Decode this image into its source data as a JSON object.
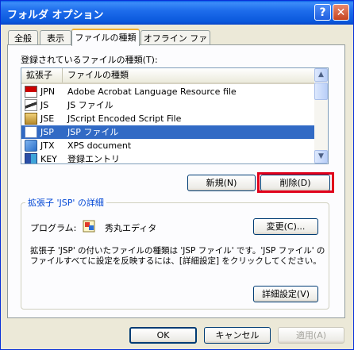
{
  "window": {
    "title": "フォルダ オプション",
    "help": "?",
    "close": "✕"
  },
  "tabs": [
    "全般",
    "表示",
    "ファイルの種類",
    "オフライン ファイル"
  ],
  "list_label": "登録されているファイルの種類(T):",
  "columns": {
    "ext": "拡張子",
    "type": "ファイルの種類"
  },
  "rows": [
    {
      "ext": "JPN",
      "type": "Adobe Acrobat Language Resource file",
      "icon": "acrobat-icon"
    },
    {
      "ext": "JS",
      "type": "JS ファイル",
      "icon": "js-file-icon"
    },
    {
      "ext": "JSE",
      "type": "JScript Encoded Script File",
      "icon": "script-icon"
    },
    {
      "ext": "JSP",
      "type": "JSP ファイル",
      "icon": "jsp-file-icon",
      "selected": true
    },
    {
      "ext": "JTX",
      "type": "XPS document",
      "icon": "xps-icon"
    },
    {
      "ext": "KEY",
      "type": "登録エントリ",
      "icon": "registry-icon"
    }
  ],
  "buttons": {
    "new": "新規(N)",
    "delete": "削除(D)",
    "change": "変更(C)...",
    "advanced": "詳細設定(V)",
    "ok": "OK",
    "cancel": "キャンセル",
    "apply": "適用(A)"
  },
  "details": {
    "group_title": "拡張子 'JSP' の詳細",
    "program_label": "プログラム:",
    "program_name": "秀丸エディタ",
    "desc_line1": "拡張子 'JSP' の付いたファイルの種類は 'JSP ファイル' です。'JSP ファイル' の",
    "desc_line2": "ファイルすべてに設定を反映するには、[詳細設定] をクリックしてください。"
  },
  "colors": {
    "title_bar": "#0A58DC",
    "selection": "#316AC5",
    "highlight_box": "#E0001B",
    "group_title": "#0046D5"
  }
}
